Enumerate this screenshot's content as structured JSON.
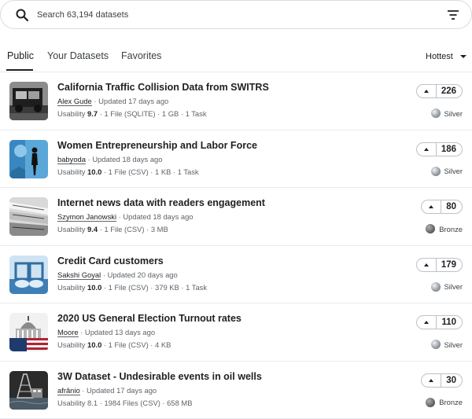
{
  "search": {
    "placeholder": "Search 63,194 datasets"
  },
  "tabs": [
    {
      "label": "Public",
      "active": true
    },
    {
      "label": "Your Datasets",
      "active": false
    },
    {
      "label": "Favorites",
      "active": false
    }
  ],
  "sort": {
    "selected": "Hottest"
  },
  "datasets": [
    {
      "title": "California Traffic Collision Data from SWITRS",
      "author": "Alex Gude",
      "updated": "Updated 17 days ago",
      "usability_label": "Usability",
      "usability": "9.7",
      "details": "1 File (SQLITE) · 1 GB · 1 Task",
      "votes": "226",
      "medal": "Silver",
      "thumb_icon": "traffic-collision-thumbnail"
    },
    {
      "title": "Women Entrepreneurship and Labor Force",
      "author": "babyoda",
      "updated": "Updated 18 days ago",
      "usability_label": "Usability",
      "usability": "10.0",
      "details": "1 File (CSV) · 1 KB · 1 Task",
      "votes": "186",
      "medal": "Silver",
      "thumb_icon": "women-silhouette-thumbnail"
    },
    {
      "title": "Internet news data with readers engagement",
      "author": "Szymon Janowski",
      "updated": "Updated 18 days ago",
      "usability_label": "Usability",
      "usability": "9.4",
      "details": "1 File (CSV) · 3 MB",
      "votes": "80",
      "medal": "Bronze",
      "thumb_icon": "newspapers-thumbnail"
    },
    {
      "title": "Credit Card customers",
      "author": "Sakshi Goyal",
      "updated": "Updated 20 days ago",
      "usability_label": "Usability",
      "usability": "10.0",
      "details": "1 File (CSV) · 379 KB · 1 Task",
      "votes": "179",
      "medal": "Silver",
      "thumb_icon": "credit-card-thumbnail"
    },
    {
      "title": "2020 US General Election Turnout rates",
      "author": "Moore",
      "updated": "Updated 13 days ago",
      "usability_label": "Usability",
      "usability": "10.0",
      "details": "1 File (CSV) · 4 KB",
      "votes": "110",
      "medal": "Silver",
      "thumb_icon": "us-capitol-thumbnail"
    },
    {
      "title": "3W Dataset - Undesirable events in oil wells",
      "author": "afrânio",
      "updated": "Updated 17 days ago",
      "usability_label": "Usability",
      "usability": "8.1",
      "details": "1984 Files (CSV) · 658 MB",
      "votes": "30",
      "medal": "Bronze",
      "thumb_icon": "oil-rig-thumbnail"
    }
  ],
  "colors": {
    "text": "#202124",
    "muted": "#5f6368",
    "border": "#dadce0",
    "divider": "#e8eaed"
  }
}
